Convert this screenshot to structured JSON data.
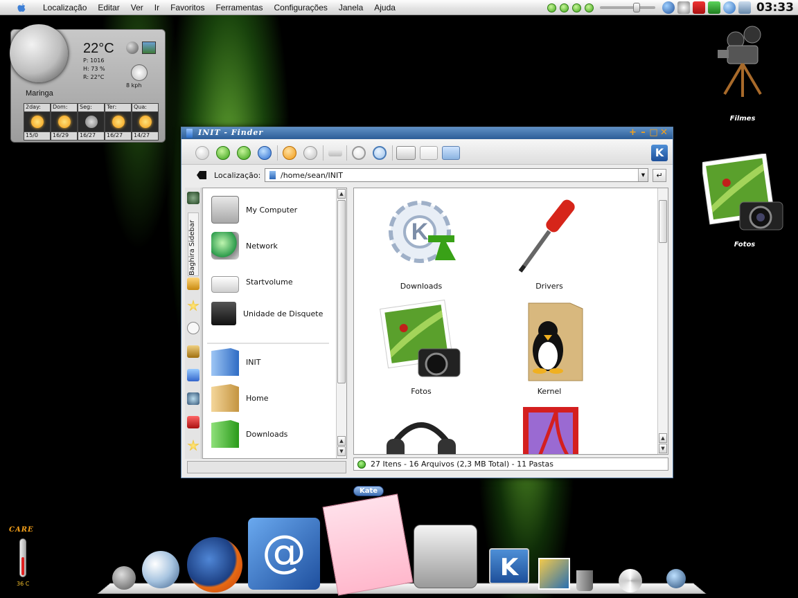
{
  "menubar": {
    "items": [
      "Localização",
      "Editar",
      "Ver",
      "Ir",
      "Favoritos",
      "Ferramentas",
      "Configurações",
      "Janela",
      "Ajuda"
    ],
    "clock": "03:33"
  },
  "weather": {
    "temperature": "22°C",
    "pressure": "P:   1016",
    "humidity": "H:   73 %",
    "real": "R:   22°C",
    "wind": "8 kph",
    "city": "Maringa",
    "days": [
      {
        "label": "2day:",
        "temp": "15/0"
      },
      {
        "label": "Dom:",
        "temp": "16/29"
      },
      {
        "label": "Seg:",
        "temp": "16/27"
      },
      {
        "label": "Ter:",
        "temp": "16/27"
      },
      {
        "label": "Qua:",
        "temp": "14/27"
      }
    ]
  },
  "desktop": {
    "filmes": "Filmes",
    "fotos": "Fotos"
  },
  "window": {
    "title": "INIT - Finder",
    "location_label": "Localização:",
    "location_value": "/home/sean/INIT",
    "sidebar_tab_label": "Baghira Sidebar",
    "sidebar_items": [
      "My Computer",
      "Network",
      "Startvolume",
      "Unidade de Disquete",
      "INIT",
      "Home",
      "Downloads"
    ],
    "files": [
      "Downloads",
      "Drivers",
      "Fotos",
      "Kernel"
    ],
    "status": "27 Itens - 16 Arquivos (2,3 MB Total) - 11 Pastas"
  },
  "tooltip": "Kate",
  "cpu": {
    "label": "CARE",
    "temp": "36 C"
  },
  "colors": {
    "title_blue": "#2b5c97",
    "accent_orange": "#f6a11a",
    "status_green": "#2c9b12"
  }
}
